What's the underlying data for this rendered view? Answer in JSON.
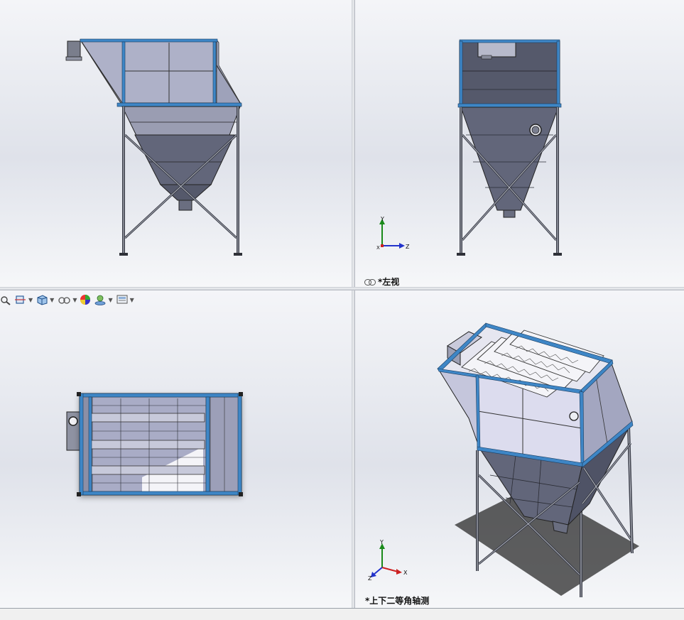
{
  "viewports": {
    "top_left": {
      "label": ""
    },
    "top_right": {
      "label": "*左视"
    },
    "bottom_left": {
      "label": ""
    },
    "bottom_right": {
      "label": "*上下二等角轴测"
    }
  },
  "triad": {
    "axis_x": "X",
    "axis_y": "Y",
    "axis_z": "Z"
  },
  "toolbar": {
    "buttons": [
      {
        "icon": "zoom-fit-icon"
      },
      {
        "icon": "section-view-icon"
      },
      {
        "icon": "view-orientation-icon"
      },
      {
        "icon": "display-style-icon"
      },
      {
        "icon": "appearance-icon"
      },
      {
        "icon": "scene-icon"
      },
      {
        "icon": "view-settings-icon"
      }
    ]
  },
  "colors": {
    "frame_blue": "#3e86c6",
    "steel_dark": "#3a3d48",
    "hopper_gray": "#6f7384",
    "panel_lavender": "#a9acc6",
    "panel_light": "#dcdcee"
  }
}
